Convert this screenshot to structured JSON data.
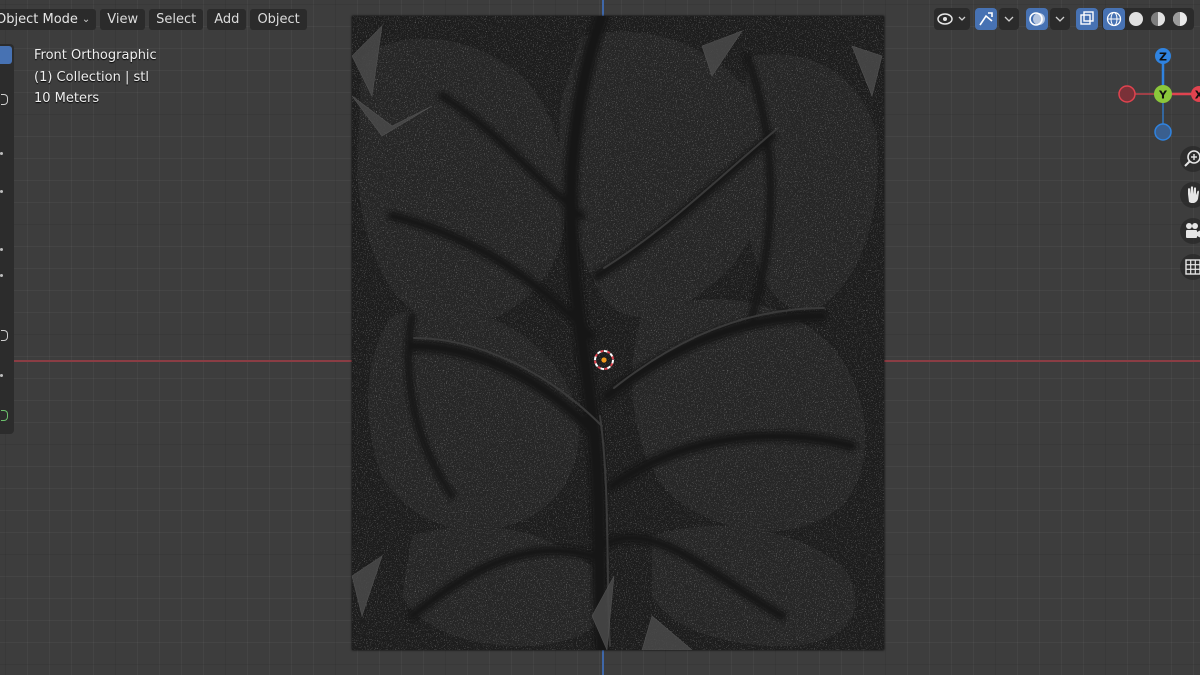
{
  "header": {
    "mode_label": "Object Mode",
    "menus": [
      "View",
      "Select",
      "Add",
      "Object"
    ]
  },
  "overlay": {
    "view_name": "Front Orthographic",
    "collection": "(1) Collection | stl",
    "scale": "10 Meters"
  },
  "gizmo": {
    "axes": [
      "Z",
      "Y",
      "X"
    ],
    "colors": {
      "x": "#e0434f",
      "y": "#8bc73b",
      "z": "#2f83e0"
    }
  },
  "colors": {
    "accent": "#4772b3",
    "x_axis_line": "#8a3d44",
    "z_axis_line": "#3f67a8",
    "origin": "#f39a1c"
  },
  "icons": {
    "toolbar": [
      "select-box-icon",
      "cursor-icon",
      "move-icon",
      "rotate-icon",
      "scale-icon",
      "transform-icon",
      "annotate-icon",
      "measure-icon",
      "add-cube-icon"
    ],
    "header_right": [
      "view-object-types-icon",
      "gizmo-icon",
      "overlays-icon",
      "xray-icon",
      "wireframe-shading-icon",
      "solid-shading-icon",
      "material-shading-icon",
      "rendered-shading-icon"
    ],
    "navigation": [
      "zoom-icon",
      "pan-hand-icon",
      "camera-icon",
      "grid-icon"
    ]
  }
}
